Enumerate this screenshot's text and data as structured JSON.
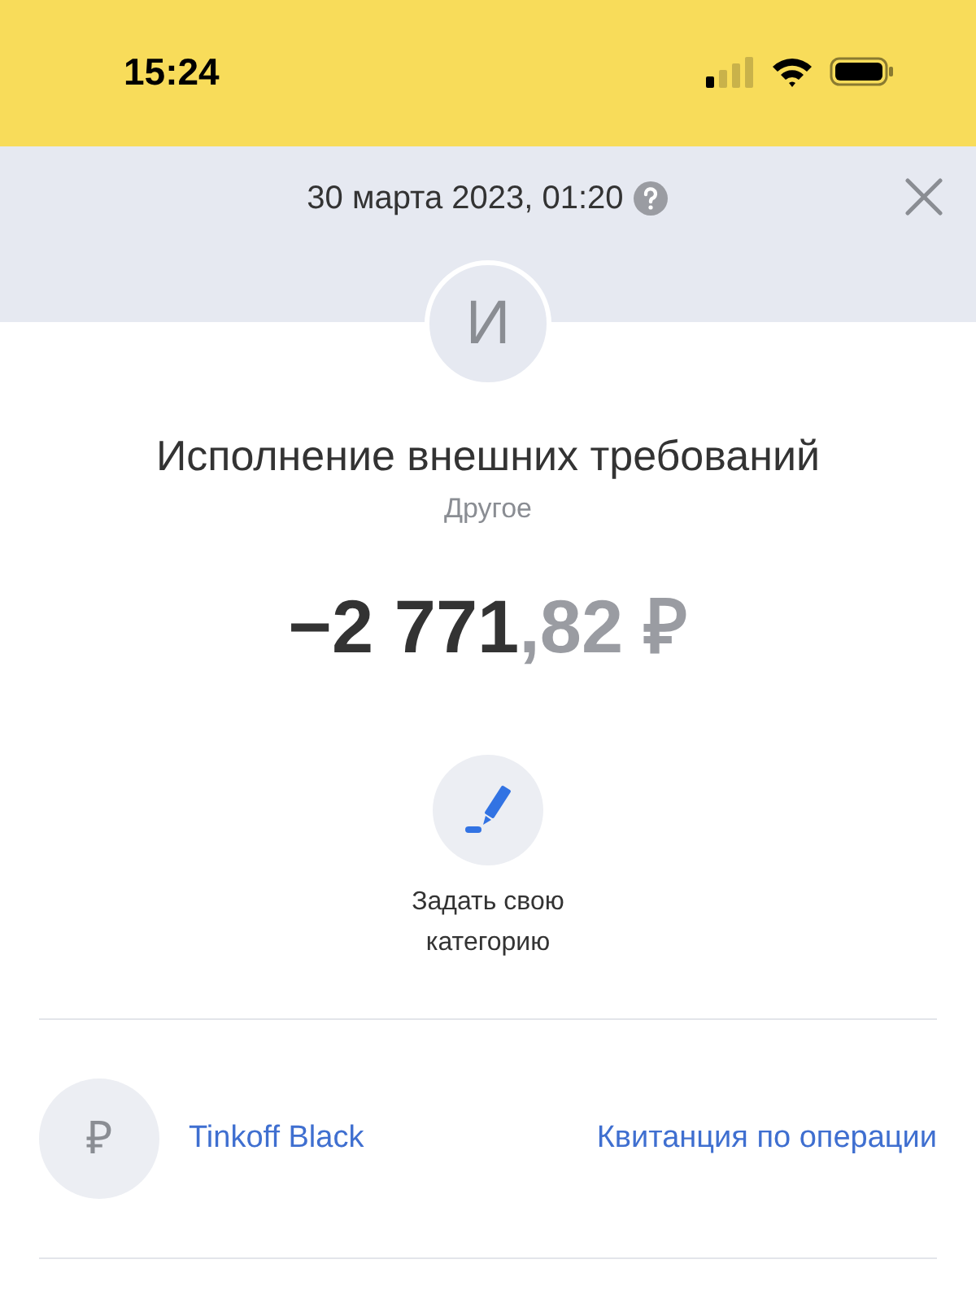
{
  "status_bar": {
    "time": "15:24"
  },
  "header": {
    "date": "30 марта 2023, 01:20"
  },
  "operation": {
    "avatar_letter": "И",
    "title": "Исполнение внешних требований",
    "category": "Другое",
    "amount_main": "−2 771",
    "amount_fraction": ",82 ₽"
  },
  "set_category": {
    "label": "Задать свою категорию"
  },
  "account": {
    "symbol": "₽",
    "name": "Tinkoff Black",
    "receipt_link": "Квитанция по операции"
  }
}
